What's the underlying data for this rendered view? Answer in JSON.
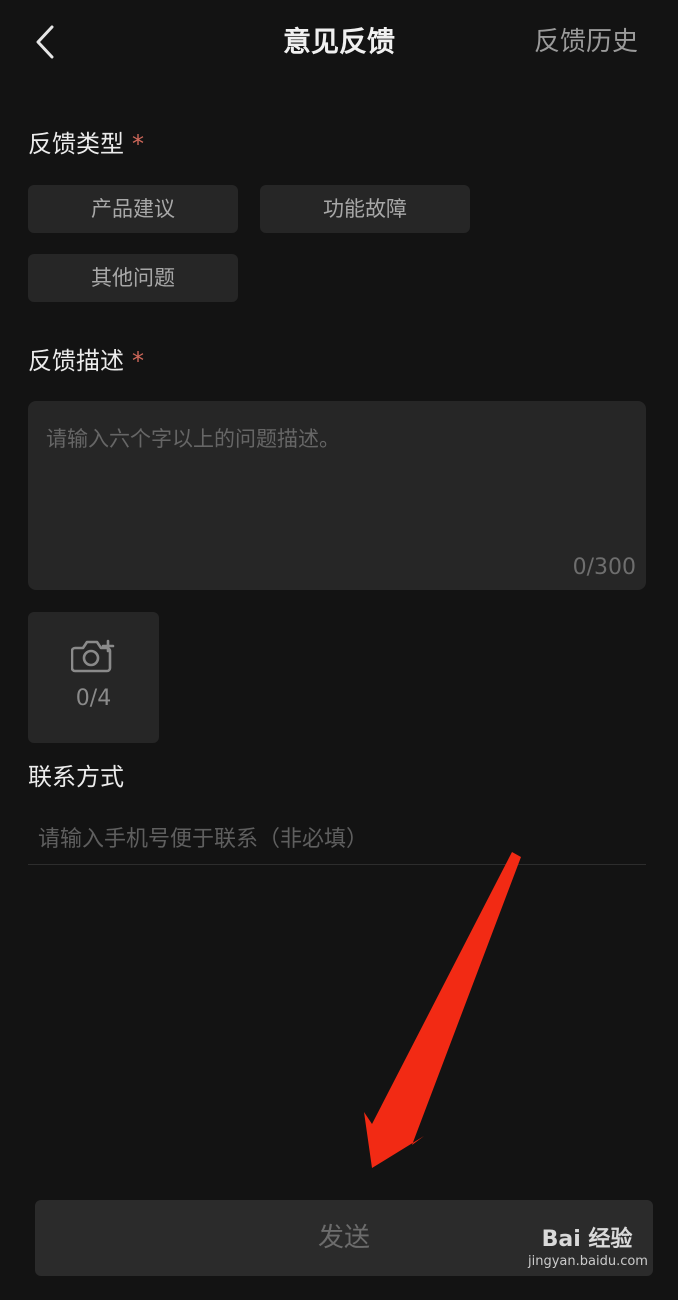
{
  "header": {
    "title": "意见反馈",
    "history_label": "反馈历史"
  },
  "feedback_type": {
    "label": "反馈类型",
    "required_mark": "*",
    "options": [
      "产品建议",
      "功能故障",
      "其他问题"
    ]
  },
  "description": {
    "label": "反馈描述",
    "required_mark": "*",
    "placeholder": "请输入六个字以上的问题描述。",
    "value": "",
    "counter": "0/300"
  },
  "photos": {
    "counter": "0/4",
    "icon": "camera-add-icon"
  },
  "contact": {
    "label": "联系方式",
    "placeholder": "请输入手机号便于联系（非必填）",
    "value": ""
  },
  "send_label": "发送",
  "watermark": {
    "logo": "Bai 经验",
    "url": "jingyan.baidu.com"
  },
  "colors": {
    "background": "#131313",
    "surface": "#262626",
    "required": "#d0685a",
    "annotation_arrow": "#f22a14"
  }
}
